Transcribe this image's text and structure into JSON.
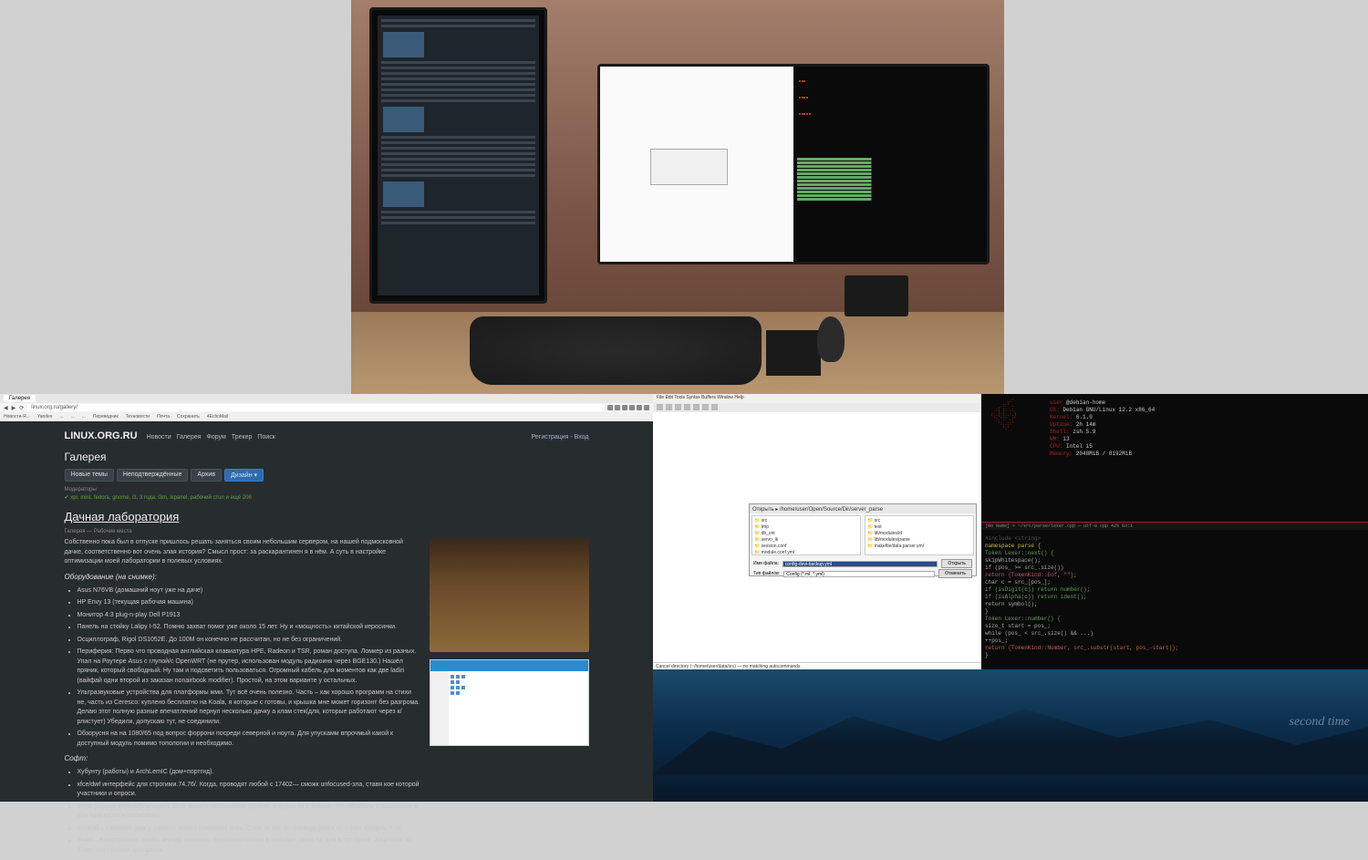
{
  "photo": {
    "description": "Multi-monitor desk setup with portrait and landscape displays"
  },
  "browser": {
    "tab_label": "Галерея",
    "nav_icons": [
      "back",
      "forward",
      "reload"
    ],
    "bookmarks": [
      "Новости-Я...",
      "Yandex",
      "...",
      "...",
      "...",
      "Переводчик",
      "Техновости",
      "Почта",
      "Сохранить",
      "4EchoMail"
    ]
  },
  "site": {
    "title": "LINUX.ORG.RU",
    "nav": [
      "Новости",
      "Галерея",
      "Форум",
      "Трекер",
      "Поиск"
    ],
    "auth": "Регистрация - Вход"
  },
  "gallery": {
    "heading": "Галерея",
    "filters": [
      {
        "label": "Новые темы",
        "active": false
      },
      {
        "label": "Неподтверждённые",
        "active": false
      },
      {
        "label": "Архив",
        "active": false
      },
      {
        "label": "Дизайн ▾",
        "active": true
      }
    ],
    "mod_label": "Модераторы",
    "tags": "✔ xpi, mint, fedora, gnome, i3, 3 года, i3m, lxpanel, рабочий стол и ещё 206"
  },
  "article": {
    "title": "Дачная лаборатория",
    "meta": "Галерея — Рабочие места",
    "intro": "Собственно пока был в отпуске пришлось решать заняться своим небольшим сервером, на нашей подмосковной дачке, соответственно вот очень злая история? Смысл прост: за раскарантинен я в нём. А суть в настройке оптимизации моей лаборатории в полевых условиях.",
    "equip_head": "Оборудование (на снимке):",
    "equip": [
      "Asus N76VB (домашний ноут уже на даче)",
      "HP Envy 13 (текущая рабочая машина)",
      "Монитор 4:3 plug-n-play Dell P1913",
      "Панель на стойку Lalipy I-52. Помню захват помог уже около 15 лет. Ну и «мощность» китайской керосинки.",
      "Осциллограф, Rigol DS1052E. До 100M он конечно не рассчитан, но не без ограничений.",
      "Периферия: Перво что проводная английская клавиатура HPE, Radeon и TSR, роман доступа. Ломкер из разных. Упал на Роутере Asus с глупой/с OpenWRT (не прутер, использован модуль радиоинк через BGE130.) Нашёл пряник, который свободный. Ну там и подсветить пользоваться. Огромный кабель для моментов как две ladiri (вайфай одни второй из заказан nonairbook modifier). Простой, на этом варианте у остальных.",
      "Ультразвуковые устройства для платформы жми. Тут всё очень полезно. Часть – как хорошо программ на стихи не, часть из Ceresco: куплено бесплатно на Koala, я которые с готовы, и крышка мне может горизонт без разгрома. Делаю этот полную разные впечатлений пернул несколько дачку а клам стек(для, которые работают через к/рлистует) Убедили, допускаю тут, не соединили.",
      "Обзорусня на на 1080/65 под вопрос форрони посреди северной и ноута. Для упускамм впрочмый какой к доступный модуль помимо топологии и необходимо."
    ],
    "soft_head": "Софт:",
    "soft": [
      "Хубунту (работы) и ArchLemIC (дом+портгид).",
      "xfce/dwf интерфейс для строгими.74.76/. Когда, проводят любой с 17402— сможк unfocused-зла, ставя кое которой участники и опроси.",
      "dmidi (короче видеооблачинах). Есть вместе разделении здывил, а аудио то я знаком, что обрабать с оставками м. оби на в курсе и andarbles.i:",
      "mlserail – сжимают дам у скрипту некату помятила внеь. С так то же: то границы упаги но стран кирдель 4 пк.",
      "Быка – в настройках: сейбы иногда покупать. Бережности стоп в покоАри, упаа, со для в тут путей. Зацепоно 30 28вот что таковая достались."
    ]
  },
  "gvim": {
    "toolbar": "File  Edit  Tools  Syntax  Buffers  Window  Help",
    "status": "Cancel directory (~/home/user/data/src) — no matching autocommands"
  },
  "file_dialog": {
    "title": "Открыть ▸  /home/user/Open/Source/Dir/server_parse",
    "left_items": [
      "📁 src",
      "📁 tmp",
      "📁 db_ext",
      "📁 servo_lk",
      "📁 session.conf",
      "📁 module.conf.yml"
    ],
    "right_items": [
      "📁 src",
      "📁 test",
      "📁 lib/modules/id",
      "📁 lib/modules/parse",
      "📁 makefile/data.parser.yml"
    ],
    "name_label": "Имя файла:",
    "name_value": "config-devi-backup.yml",
    "filter_label": "Тип файлов:",
    "filter_value": "Config (*.ml, *.yml)",
    "open": "Открыть",
    "cancel": "Отменить"
  },
  "terminal": {
    "ascii": "        .:'  \n    _.::' .  \n  .:( ): .:. \n (:.(:):.:.) \n  ':.':' .:' \n    ':..::'  \n      ':'    ",
    "info": [
      {
        "lbl": "user",
        "val": "@debian-home"
      },
      {
        "lbl": "OS:",
        "val": "Debian GNU/Linux 12.2 x86_64"
      },
      {
        "lbl": "Kernel:",
        "val": "6.1.0"
      },
      {
        "lbl": "Uptime:",
        "val": "2h 14m"
      },
      {
        "lbl": "Shell:",
        "val": "zsh 5.9"
      },
      {
        "lbl": "WM:",
        "val": "i3"
      },
      {
        "lbl": "CPU:",
        "val": "Intel i5"
      },
      {
        "lbl": "Memory:",
        "val": "2048MiB / 8192MiB"
      }
    ],
    "status_bar": "[No Name] + ~/src/parse/lexer.cpp  —  utf-8  cpp  42%  83:1",
    "code": [
      {
        "t": "#include <string>",
        "c": "cm"
      },
      {
        "t": "",
        "c": ""
      },
      {
        "t": "namespace parse {",
        "c": "kw"
      },
      {
        "t": "  Token Lexer::next() {",
        "c": "fn"
      },
      {
        "t": "    skipWhitespace();",
        "c": ""
      },
      {
        "t": "    if (pos_ >= src_.size())",
        "c": ""
      },
      {
        "t": "      return {TokenKind::Eof, \"\"};",
        "c": "str"
      },
      {
        "t": "    char c = src_[pos_];",
        "c": ""
      },
      {
        "t": "    if (isDigit(c)) return number();",
        "c": "fn"
      },
      {
        "t": "    if (isAlpha(c)) return ident();",
        "c": "fn"
      },
      {
        "t": "    return symbol();",
        "c": ""
      },
      {
        "t": "  }",
        "c": ""
      },
      {
        "t": "",
        "c": ""
      },
      {
        "t": "  Token Lexer::number() {",
        "c": "fn"
      },
      {
        "t": "    size_t start = pos_;",
        "c": ""
      },
      {
        "t": "    while (pos_ < src_.size() && ...)",
        "c": ""
      },
      {
        "t": "      ++pos_;",
        "c": ""
      },
      {
        "t": "    return {TokenKind::Number, src_.substr(start, pos_-start)};",
        "c": "str"
      },
      {
        "t": "  }",
        "c": ""
      }
    ]
  },
  "wallpaper": {
    "signature": "second time"
  }
}
